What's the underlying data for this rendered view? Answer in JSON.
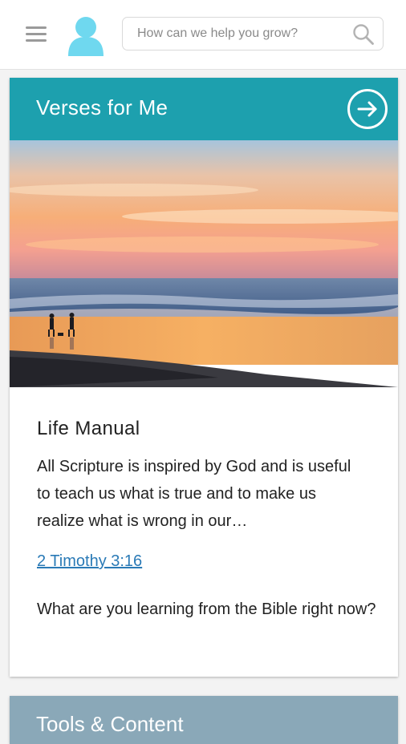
{
  "header": {
    "search_placeholder": "How can we help you grow?",
    "icons": [
      "hamburger-menu-icon",
      "user-avatar-icon",
      "search-icon"
    ]
  },
  "card": {
    "title": "Verses for Me",
    "header_color": "#1da0ae",
    "arrow_icon": "arrow-right-circle-icon",
    "verse_title": "Life Manual",
    "verse_text": "All Scripture is inspired by God and is useful to teach us what is true and to make us realize what is wrong in our…",
    "reference": "2 Timothy 3:16",
    "reference_color": "#2a7ab6",
    "prompt": "What are you learning from the Bible right now?"
  },
  "next_card": {
    "title": "Tools & Content",
    "header_color": "#8aa8b8"
  }
}
